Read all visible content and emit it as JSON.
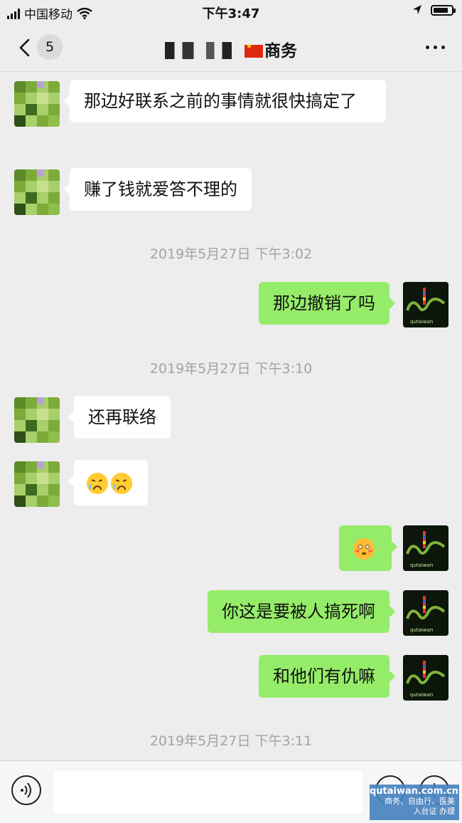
{
  "status_bar": {
    "carrier": "中国移动",
    "time": "下午3:47"
  },
  "nav": {
    "back_count": "5",
    "title_suffix": "商务"
  },
  "messages": [
    {
      "side": "in",
      "text": "那边好联系之前的事情就很快搞定了"
    },
    {
      "side": "in",
      "text": "赚了钱就爱答不理的"
    },
    {
      "side": "out",
      "text": "那边撤销了吗"
    },
    {
      "side": "in",
      "text": "还再联络"
    },
    {
      "side": "in",
      "emoji": [
        "angry-tears-emoji",
        "angry-tears-emoji"
      ]
    },
    {
      "side": "out",
      "emoji": [
        "flushed-emoji"
      ]
    },
    {
      "side": "out",
      "text": "你这是要被人搞死啊"
    },
    {
      "side": "out",
      "text": "和他们有仇嘛"
    }
  ],
  "timestamps": [
    "2019年5月27日 下午3:02",
    "2019年5月27日 下午3:10",
    "2019年5月27日 下午3:11"
  ],
  "watermark": {
    "site": "qutaiwan.com.cn",
    "line2": "商务、自由行、医美",
    "line3": "入台证 办理"
  },
  "colors": {
    "background": "#ededed",
    "outgoing_bubble": "#95ec69",
    "incoming_bubble": "#ffffff",
    "timestamp": "#a3a3a3"
  }
}
